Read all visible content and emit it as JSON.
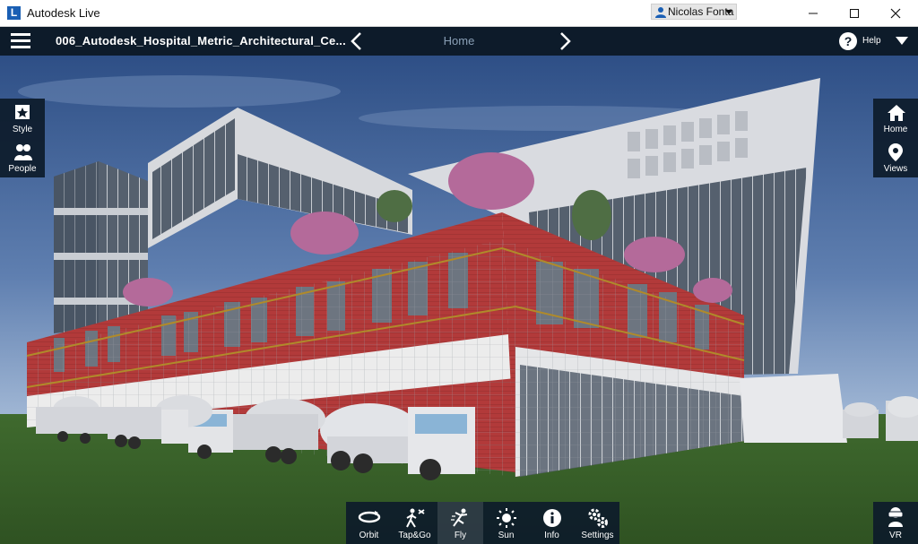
{
  "window": {
    "app_title": "Autodesk Live",
    "logo_letter": "L",
    "user_name": "Nicolas Fonta"
  },
  "header": {
    "project_title": "006_Autodesk_Hospital_Metric_Architectural_Ce...",
    "current_view": "Home",
    "help_label": "Help"
  },
  "left_panel": [
    {
      "label": "Style",
      "icon": "style-icon"
    },
    {
      "label": "People",
      "icon": "people-icon"
    }
  ],
  "right_panel": [
    {
      "label": "Home",
      "icon": "home-icon"
    },
    {
      "label": "Views",
      "icon": "views-pin-icon"
    }
  ],
  "toolbar": {
    "items": [
      {
        "label": "Orbit",
        "icon": "orbit-icon"
      },
      {
        "label": "Tap&Go",
        "icon": "tap-go-icon"
      },
      {
        "label": "Fly",
        "icon": "fly-icon",
        "active": true
      },
      {
        "label": "Sun",
        "icon": "sun-icon"
      },
      {
        "label": "Info",
        "icon": "info-icon"
      },
      {
        "label": "Settings",
        "icon": "settings-icon"
      }
    ]
  },
  "vr": {
    "label": "VR",
    "icon": "vr-headset-icon"
  },
  "colors": {
    "header_bg": "#0d1b2a",
    "sky_top": "#2e4f86",
    "sky_bottom": "#a3b9d6",
    "grass": "#4a7a35",
    "brick": "#b23a3a"
  }
}
